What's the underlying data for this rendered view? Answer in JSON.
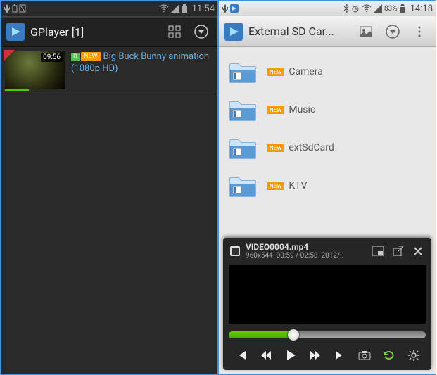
{
  "left": {
    "status": {
      "clock": "11:54"
    },
    "header": {
      "title": "GPlayer [1]"
    },
    "video": {
      "duration": "09:56",
      "title": "Big Buck Bunny animation",
      "subtitle": "(1080p HD)",
      "new_label": "NEW"
    }
  },
  "right": {
    "status": {
      "battery_pct": "83%",
      "clock": "14:18"
    },
    "header": {
      "title": "External SD Car..."
    },
    "folders": [
      {
        "name": "Camera",
        "new": "NEW"
      },
      {
        "name": "Music",
        "new": "NEW"
      },
      {
        "name": "extSdCard",
        "new": "NEW"
      },
      {
        "name": "KTV",
        "new": "NEW"
      }
    ],
    "player": {
      "filename": "VIDEO0004.mp4",
      "resolution": "960x544",
      "time": "00:59 / 02:58",
      "date": "2012/..",
      "progress_pct": 33
    }
  }
}
